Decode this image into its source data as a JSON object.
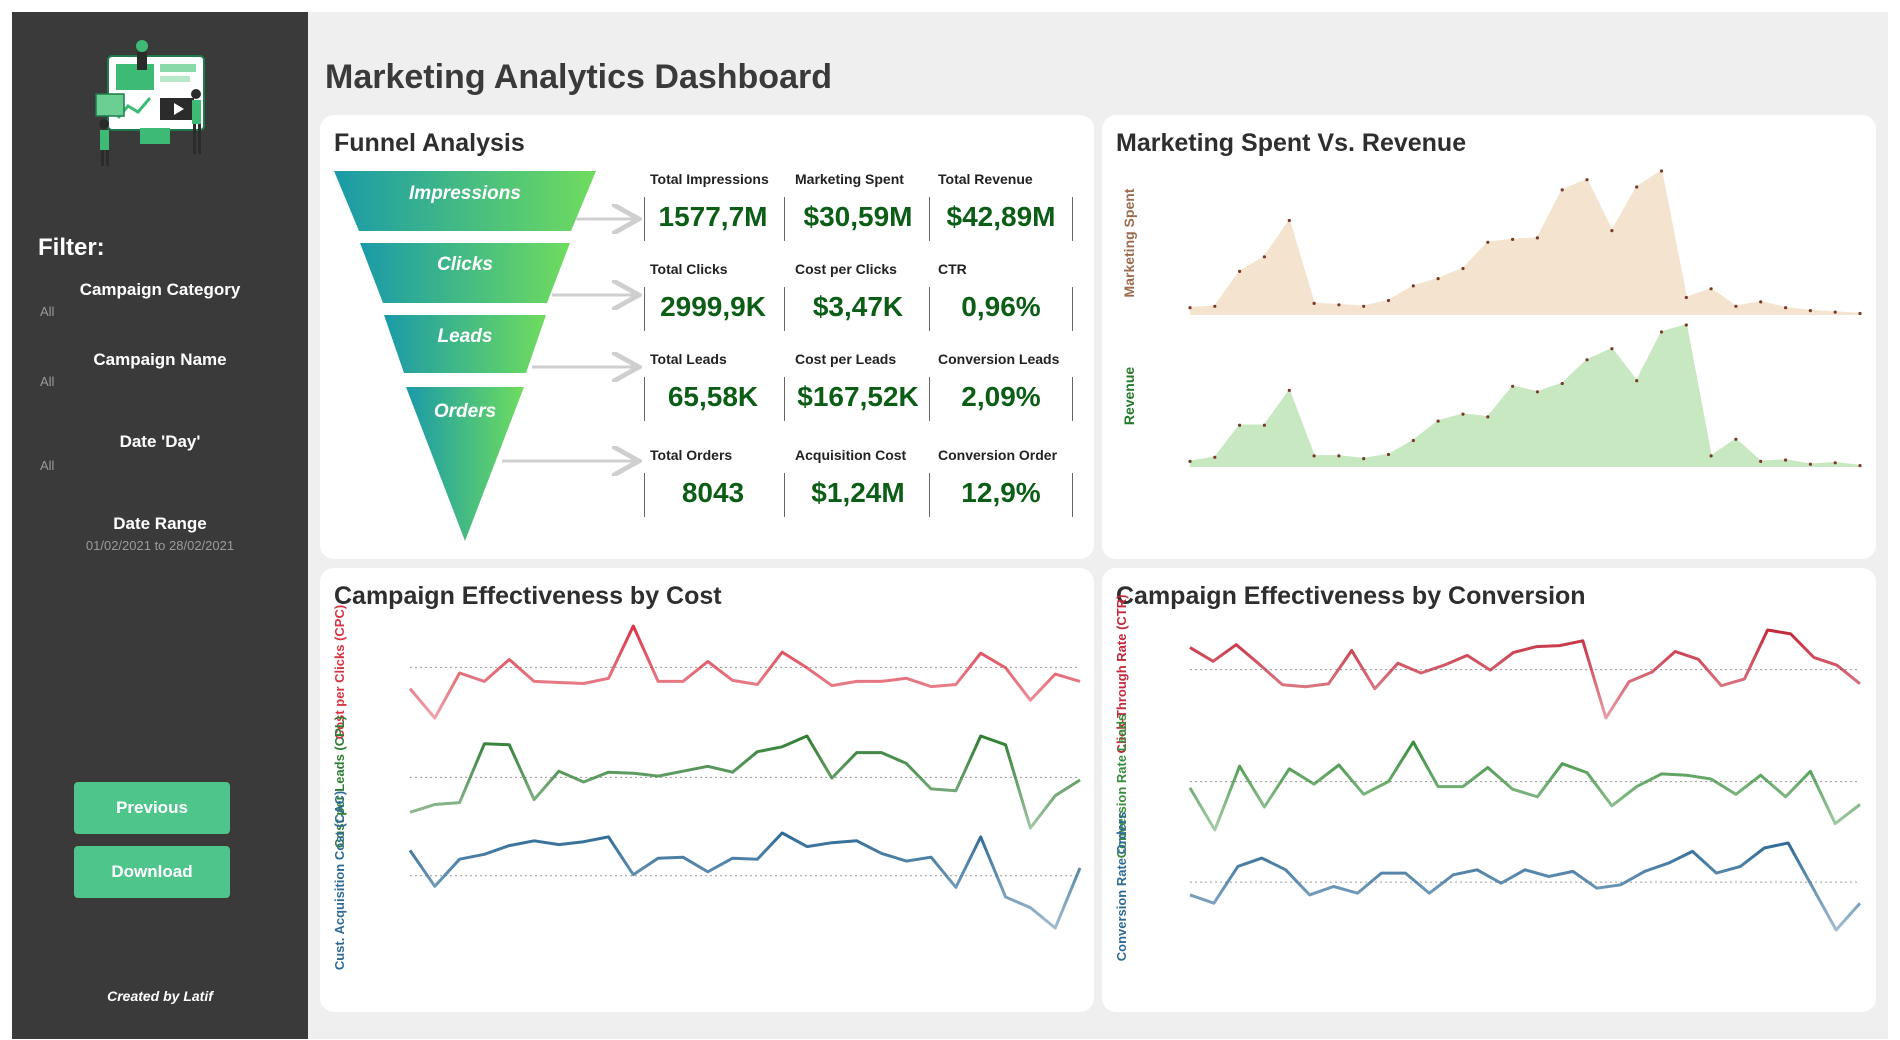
{
  "dashboard_title": "Marketing Analytics Dashboard",
  "sidebar": {
    "filter_title": "Filter:",
    "filters": [
      {
        "label": "Campaign Category",
        "value": "All"
      },
      {
        "label": "Campaign Name",
        "value": "All"
      },
      {
        "label": "Date 'Day'",
        "value": "All"
      },
      {
        "label": "Date Range",
        "value": "01/02/2021 to 28/02/2021"
      }
    ],
    "previous_label": "Previous",
    "download_label": "Download",
    "credit": "Created by Latif",
    "logo_icon": "marketing-illustration-icon"
  },
  "funnel": {
    "title": "Funnel Analysis",
    "stages": [
      "Impressions",
      "Clicks",
      "Leads",
      "Orders"
    ],
    "kpis": [
      [
        {
          "label": "Total Impressions",
          "value": "1577,7M"
        },
        {
          "label": "Marketing Spent",
          "value": "$30,59M"
        },
        {
          "label": "Total Revenue",
          "value": "$42,89M"
        }
      ],
      [
        {
          "label": "Total Clicks",
          "value": "2999,9K"
        },
        {
          "label": "Cost per Clicks",
          "value": "$3,47K"
        },
        {
          "label": "CTR",
          "value": "0,96%"
        }
      ],
      [
        {
          "label": "Total Leads",
          "value": "65,58K"
        },
        {
          "label": "Cost per Leads",
          "value": "$167,52K"
        },
        {
          "label": "Conversion Leads",
          "value": "2,09%"
        }
      ],
      [
        {
          "label": "Total Orders",
          "value": "8043"
        },
        {
          "label": "Acquisition Cost",
          "value": "$1,24M"
        },
        {
          "label": "Conversion Order",
          "value": "12,9%"
        }
      ]
    ],
    "colors": {
      "kpi_value": "#0c5e16",
      "funnel_start": "#1a9aa8",
      "funnel_end": "#6fdc5e"
    }
  },
  "spent_revenue": {
    "title": "Marketing Spent Vs. Revenue",
    "chart_data": {
      "type": "area",
      "series": [
        {
          "name": "Marketing Spent",
          "color": "#9c6b4f",
          "fill": "#f3e3cf",
          "values": [
            5,
            6,
            30,
            40,
            65,
            8,
            7,
            6,
            10,
            20,
            25,
            32,
            50,
            52,
            53,
            86,
            93,
            58,
            88,
            99,
            12,
            18,
            6,
            9,
            5,
            3,
            2,
            1
          ]
        },
        {
          "name": "Revenue",
          "color": "#237a2a",
          "fill": "#c7e8c0",
          "values": [
            4,
            7,
            30,
            30,
            55,
            8,
            8,
            6,
            9,
            19,
            33,
            38,
            36,
            58,
            54,
            60,
            77,
            85,
            62,
            97,
            102,
            8,
            20,
            4,
            5,
            2,
            3,
            1
          ]
        }
      ]
    }
  },
  "campaign_cost": {
    "title": "Campaign Effectiveness by Cost",
    "chart_data": {
      "type": "line",
      "series": [
        {
          "name": "Cost per Clicks (CPC)",
          "color": "#d93444",
          "values": [
            40,
            12,
            55,
            47,
            68,
            47,
            46,
            45,
            50,
            100,
            47,
            47,
            66,
            48,
            44,
            75,
            60,
            43,
            47,
            47,
            50,
            42,
            44,
            74,
            60,
            29,
            54,
            47
          ]
        },
        {
          "name": "Cost per Leads (CPL)",
          "color": "#2e7d32",
          "values": [
            30,
            38,
            40,
            100,
            99,
            43,
            72,
            61,
            71,
            70,
            67,
            72,
            77,
            71,
            92,
            97,
            108,
            65,
            91,
            91,
            80,
            54,
            52,
            108,
            99,
            14,
            47,
            63
          ]
        },
        {
          "name": "Cust. Acquisition Cost (CAC)",
          "color": "#2e6a96",
          "values": [
            82,
            45,
            73,
            78,
            87,
            92,
            88,
            91,
            96,
            57,
            74,
            75,
            60,
            74,
            73,
            100,
            86,
            90,
            92,
            79,
            71,
            75,
            44,
            96,
            34,
            23,
            2,
            64
          ]
        }
      ]
    }
  },
  "campaign_conversion": {
    "title": "Campaign Effectiveness by Conversion",
    "chart_data": {
      "type": "line",
      "series": [
        {
          "name": "Click-Through Rate (CTR)",
          "color": "#c4283a",
          "values": [
            78,
            64,
            81,
            61,
            40,
            38,
            41,
            75,
            36,
            62,
            52,
            60,
            70,
            55,
            73,
            79,
            80,
            85,
            6,
            43,
            53,
            74,
            66,
            39,
            46,
            96,
            92,
            68,
            60,
            41
          ]
        },
        {
          "name": "Conversion Rate Leads",
          "color": "#388e3c",
          "values": [
            63,
            30,
            80,
            48,
            78,
            66,
            81,
            58,
            68,
            99,
            64,
            64,
            79,
            62,
            56,
            82,
            75,
            49,
            64,
            74,
            73,
            70,
            58,
            73,
            56,
            76,
            35,
            50
          ]
        },
        {
          "name": "Conversion Rate Orders",
          "color": "#2e6a96",
          "values": [
            43,
            38,
            60,
            65,
            58,
            43,
            48,
            44,
            56,
            56,
            44,
            55,
            58,
            50,
            58,
            54,
            57,
            47,
            49,
            57,
            62,
            69,
            56,
            60,
            71,
            74,
            48,
            22,
            38
          ]
        }
      ]
    }
  }
}
